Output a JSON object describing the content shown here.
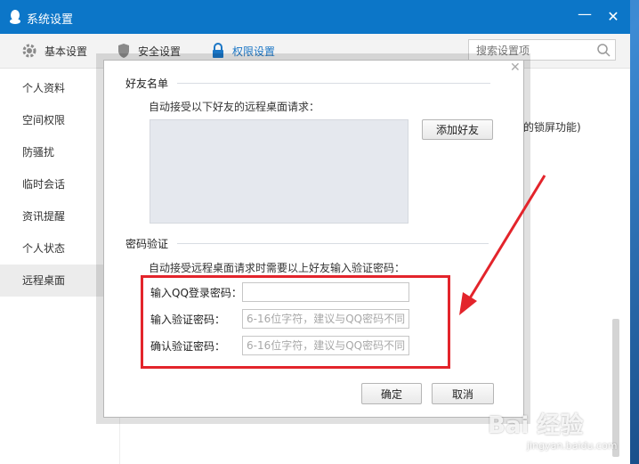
{
  "window": {
    "title": "系统设置"
  },
  "toolbar": {
    "items": [
      {
        "label": "基本设置",
        "icon": "gear-icon"
      },
      {
        "label": "安全设置",
        "icon": "shield-icon"
      },
      {
        "label": "权限设置",
        "icon": "lock-icon"
      }
    ],
    "search_placeholder": "搜索设置项"
  },
  "sidebar": {
    "items": [
      {
        "label": "个人资料"
      },
      {
        "label": "空间权限"
      },
      {
        "label": "防骚扰"
      },
      {
        "label": "临时会话"
      },
      {
        "label": "资讯提醒"
      },
      {
        "label": "个人状态"
      },
      {
        "label": "远程桌面"
      }
    ],
    "active_index": 6
  },
  "background_text": "的锁屏功能)",
  "dialog": {
    "friend_section": {
      "title": "好友名单",
      "description": "自动接受以下好友的远程桌面请求：",
      "add_button": "添加好友"
    },
    "password_section": {
      "title": "密码验证",
      "description": "自动接受远程桌面请求时需要以上好友输入验证密码：",
      "rows": [
        {
          "label": "输入QQ登录密码：",
          "value": "",
          "placeholder": ""
        },
        {
          "label": "输入验证密码：",
          "value": "",
          "placeholder": "6-16位字符，建议与QQ密码不同"
        },
        {
          "label": "确认验证密码：",
          "value": "",
          "placeholder": "6-16位字符，建议与QQ密码不同"
        }
      ]
    },
    "ok_button": "确定",
    "cancel_button": "取消"
  },
  "annotation_color": "#e3242b",
  "accent_color": "#0c76c8",
  "watermark": {
    "brand": "Bai 经验",
    "url": "jingyan.baidu.com"
  }
}
